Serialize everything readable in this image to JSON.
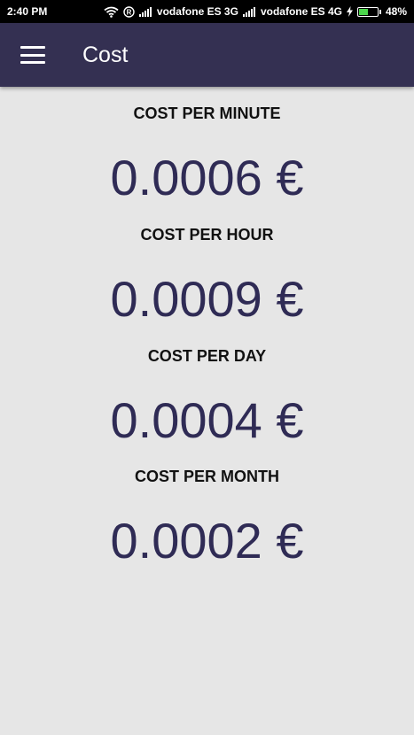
{
  "status_bar": {
    "time": "2:40 PM",
    "carrier1": "vodafone ES 3G",
    "carrier2": "vodafone ES 4G",
    "battery": "48%",
    "battery_level": 0.48,
    "icons": [
      "wifi-icon",
      "roaming-icon",
      "signal-icon",
      "signal-icon",
      "charging-icon",
      "battery-icon"
    ]
  },
  "app_bar": {
    "title": "Cost",
    "menu_icon": "hamburger-menu-icon",
    "background": "#343052"
  },
  "costs": [
    {
      "label": "COST PER MINUTE",
      "value": "0.0006 €"
    },
    {
      "label": "COST PER HOUR",
      "value": "0.0009 €"
    },
    {
      "label": "COST PER DAY",
      "value": "0.0004 €"
    },
    {
      "label": "COST PER MONTH",
      "value": "0.0002 €"
    }
  ],
  "colors": {
    "accent": "#2f2b55",
    "background": "#e6e6e6"
  }
}
